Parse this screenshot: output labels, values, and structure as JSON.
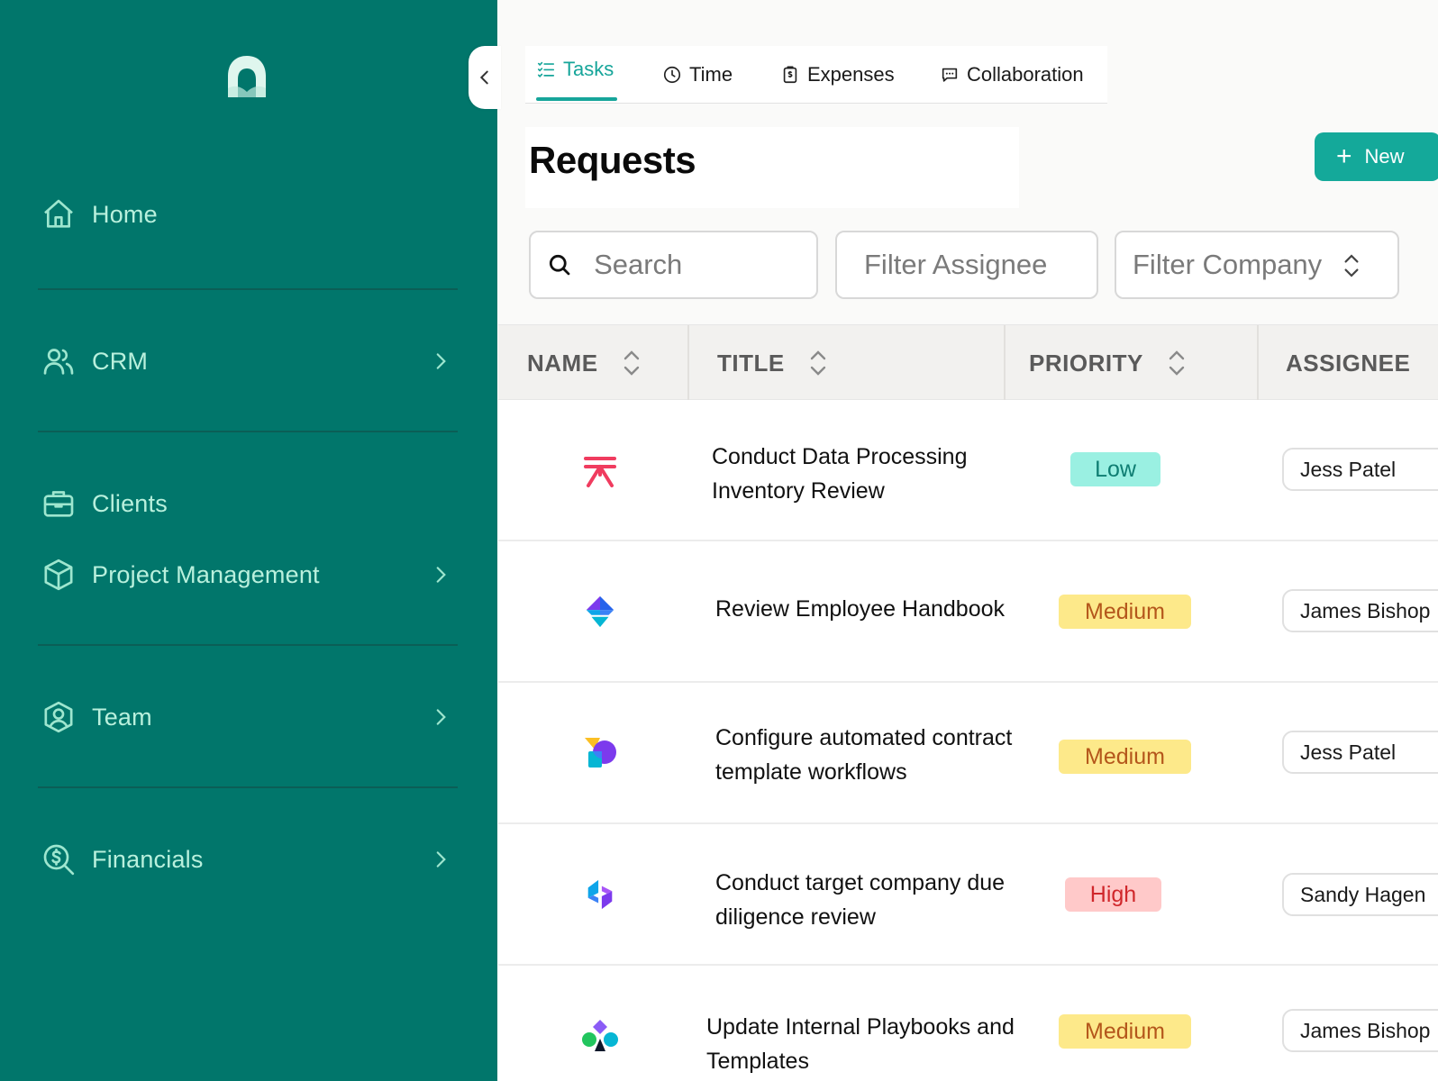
{
  "sidebar": {
    "items": [
      {
        "label": "Home",
        "icon": "home-icon"
      },
      {
        "label": "CRM",
        "icon": "users-icon"
      },
      {
        "label": "Clients",
        "icon": "briefcase-icon"
      },
      {
        "label": "Project Management",
        "icon": "cube-icon"
      },
      {
        "label": "Team",
        "icon": "user-circle-icon"
      },
      {
        "label": "Financials",
        "icon": "search-dollar-icon"
      }
    ]
  },
  "tabs": [
    {
      "label": "Tasks",
      "icon": "checklist-icon",
      "active": true
    },
    {
      "label": "Time",
      "icon": "clock-icon"
    },
    {
      "label": "Expenses",
      "icon": "receipt-icon"
    },
    {
      "label": "Collaboration",
      "icon": "chat-icon"
    }
  ],
  "page": {
    "title": "Requests",
    "new_button": "New"
  },
  "filters": {
    "search_placeholder": "Search",
    "assignee_placeholder": "Filter Assignee",
    "company_placeholder": "Filter Company"
  },
  "table": {
    "headers": {
      "name": "NAME",
      "title": "TITLE",
      "priority": "PRIORITY",
      "assignee": "ASSIGNEE"
    },
    "rows": [
      {
        "title_line1": "Conduct Data Processing",
        "title_line2": "Inventory Review",
        "priority": "Low",
        "assignee": "Jess Patel",
        "logo": "red-trident-logo"
      },
      {
        "title_line1": "Review Employee Handbook",
        "title_line2": "",
        "priority": "Medium",
        "assignee": "James Bishop",
        "logo": "blue-diamond-logo"
      },
      {
        "title_line1": "Configure automated contract",
        "title_line2": "template workflows",
        "priority": "Medium",
        "assignee": "Jess Patel",
        "logo": "purple-blob-logo"
      },
      {
        "title_line1": "Conduct target company due",
        "title_line2": "diligence review",
        "priority": "High",
        "assignee": "Sandy Hagen",
        "logo": "blue-purple-arrows-logo"
      },
      {
        "title_line1": "Update Internal Playbooks and",
        "title_line2": "Templates",
        "priority": "Medium",
        "assignee": "James Bishop",
        "logo": "multicolor-club-logo"
      }
    ]
  },
  "colors": {
    "sidebar_bg": "#01766b",
    "accent": "#14a99a",
    "nav_text": "#b9f0dd",
    "low_badge": "#9af0e2",
    "medium_badge": "#fde98a",
    "high_badge": "#ffc9c9"
  }
}
